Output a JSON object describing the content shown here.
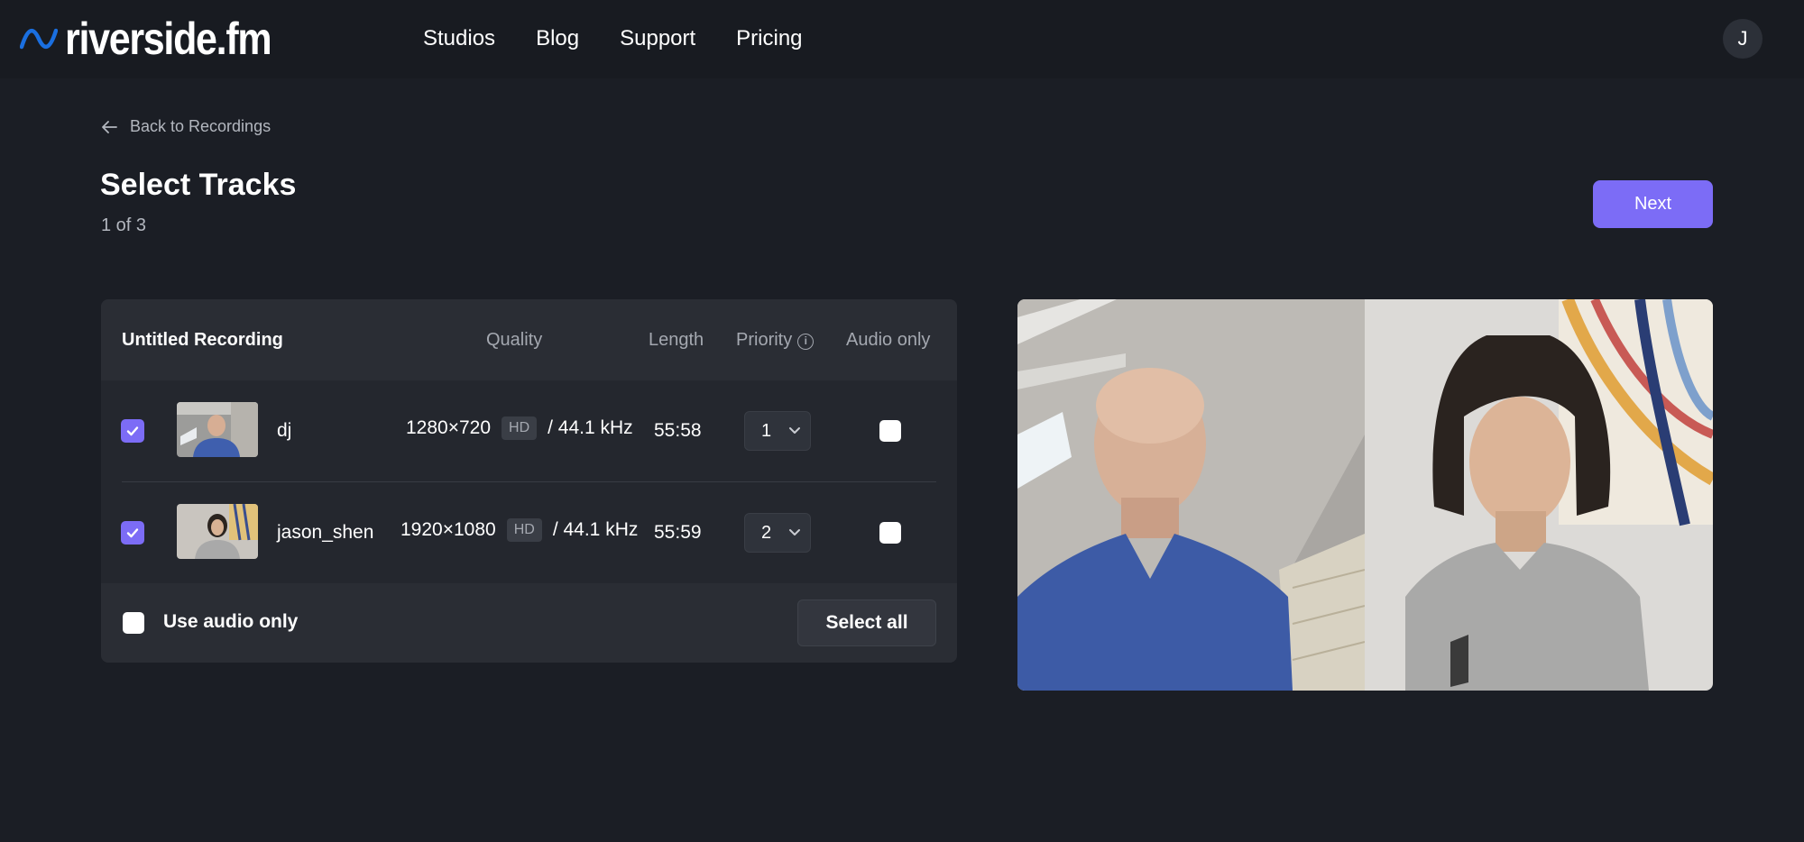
{
  "app": {
    "logo_text": "riverside.fm",
    "brand_color": "#1a6fe0",
    "accent_color": "#7c6cf6"
  },
  "nav": {
    "items": [
      {
        "label": "Studios"
      },
      {
        "label": "Blog"
      },
      {
        "label": "Support"
      },
      {
        "label": "Pricing"
      }
    ]
  },
  "user": {
    "avatar_initial": "J"
  },
  "back_link": {
    "label": "Back to Recordings",
    "icon": "arrow-left-icon"
  },
  "page": {
    "title": "Select Tracks",
    "step": "1 of 3",
    "next_label": "Next"
  },
  "table": {
    "recording_name": "Untitled Recording",
    "columns": {
      "quality": "Quality",
      "length": "Length",
      "priority": "Priority",
      "audio_only": "Audio only"
    },
    "rows": [
      {
        "selected": true,
        "name": "dj",
        "resolution": "1280×720",
        "badge": "HD",
        "sample_rate": "/ 44.1 kHz",
        "length": "55:58",
        "priority": "1",
        "audio_only": false
      },
      {
        "selected": true,
        "name": "jason_shen",
        "resolution": "1920×1080",
        "badge": "HD",
        "sample_rate": "/ 44.1 kHz",
        "length": "55:59",
        "priority": "2",
        "audio_only": false
      }
    ]
  },
  "footer": {
    "use_audio_only_label": "Use audio only",
    "use_audio_only_checked": false,
    "select_all_label": "Select all"
  }
}
